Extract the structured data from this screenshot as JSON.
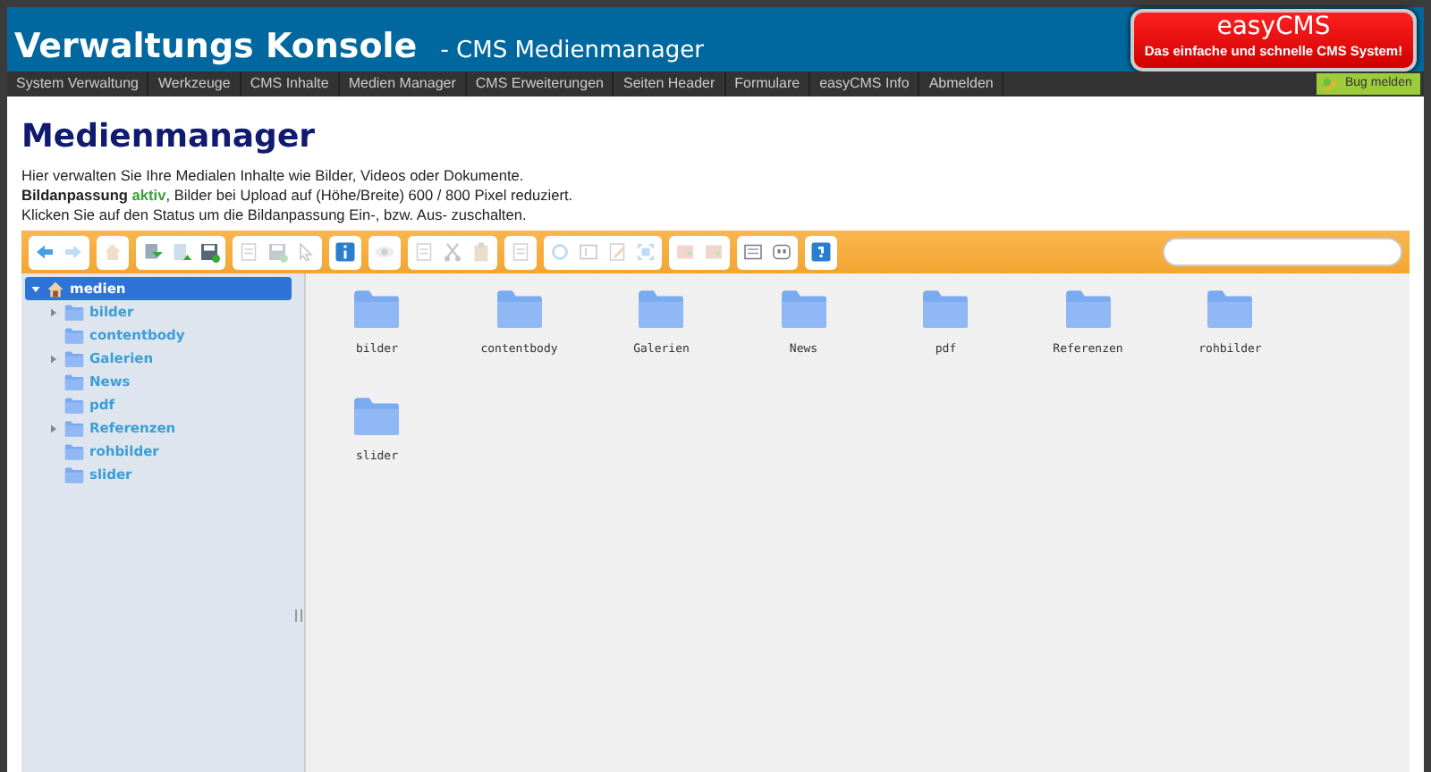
{
  "header": {
    "title": "Verwaltungs Konsole",
    "subtitle": "- CMS Medienmanager",
    "logo": {
      "name": "easyCMS",
      "tagline": "Das einfache und schnelle CMS System!"
    }
  },
  "nav": {
    "items": [
      "System Verwaltung",
      "Werkzeuge",
      "CMS Inhalte",
      "Medien Manager",
      "CMS Erweiterungen",
      "Seiten Header",
      "Formulare",
      "easyCMS Info",
      "Abmelden"
    ],
    "bug_button": "Bug melden"
  },
  "page": {
    "heading": "Medienmanager",
    "lines": [
      "Hier verwalten Sie Ihre Medialen Inhalte wie Bilder, Videos oder Dokumente.",
      "**Bildanpassung** ",
      "Klicken Sie auf den Status um die Bildanpassung Ein-, bzw. Aus- zuschalten."
    ],
    "status_link": "aktiv",
    "status_rest": ", Bilder bei Upload auf (Höhe/Breite) 600 / 800 Pixel reduziert."
  },
  "toolbar": {
    "groups": [
      [
        {
          "kind": "back",
          "disabled": false
        },
        {
          "kind": "forward",
          "disabled": true
        }
      ],
      [
        {
          "kind": "home",
          "disabled": true
        }
      ],
      [
        {
          "kind": "download",
          "disabled": false
        },
        {
          "kind": "upload",
          "disabled": false
        },
        {
          "kind": "save",
          "disabled": false
        }
      ],
      [
        {
          "kind": "doc",
          "disabled": true
        },
        {
          "kind": "save",
          "disabled": true
        },
        {
          "kind": "select",
          "disabled": true
        }
      ],
      [
        {
          "kind": "info",
          "disabled": false
        }
      ],
      [
        {
          "kind": "eye",
          "disabled": true
        }
      ],
      [
        {
          "kind": "doc",
          "disabled": true
        },
        {
          "kind": "cut",
          "disabled": true
        },
        {
          "kind": "paste",
          "disabled": true
        }
      ],
      [
        {
          "kind": "doc",
          "disabled": true
        }
      ],
      [
        {
          "kind": "rotate",
          "disabled": true
        },
        {
          "kind": "text",
          "disabled": true
        },
        {
          "kind": "edit",
          "disabled": true
        },
        {
          "kind": "resize",
          "disabled": true
        }
      ],
      [
        {
          "kind": "archive",
          "disabled": true
        },
        {
          "kind": "archive",
          "disabled": true
        }
      ],
      [
        {
          "kind": "list",
          "disabled": false
        },
        {
          "kind": "icons",
          "disabled": false
        }
      ],
      [
        {
          "kind": "help",
          "disabled": false
        }
      ]
    ]
  },
  "tree": {
    "label": "medien",
    "expanded": true,
    "selected": true,
    "children": [
      {
        "label": "bilder",
        "has_children": true,
        "selected": false
      },
      {
        "label": "contentbody",
        "has_children": false,
        "selected": false
      },
      {
        "label": "Galerien",
        "has_children": true,
        "selected": false
      },
      {
        "label": "News",
        "has_children": false,
        "selected": false
      },
      {
        "label": "pdf",
        "has_children": false,
        "selected": false
      },
      {
        "label": "Referenzen",
        "has_children": true,
        "selected": false
      },
      {
        "label": "rohbilder",
        "has_children": false,
        "selected": false
      },
      {
        "label": "slider",
        "has_children": false,
        "selected": false
      }
    ]
  },
  "files": [
    {
      "name": "bilder"
    },
    {
      "name": "contentbody"
    },
    {
      "name": "Galerien"
    },
    {
      "name": "News"
    },
    {
      "name": "pdf"
    },
    {
      "name": "Referenzen"
    },
    {
      "name": "rohbilder"
    },
    {
      "name": "slider"
    }
  ]
}
